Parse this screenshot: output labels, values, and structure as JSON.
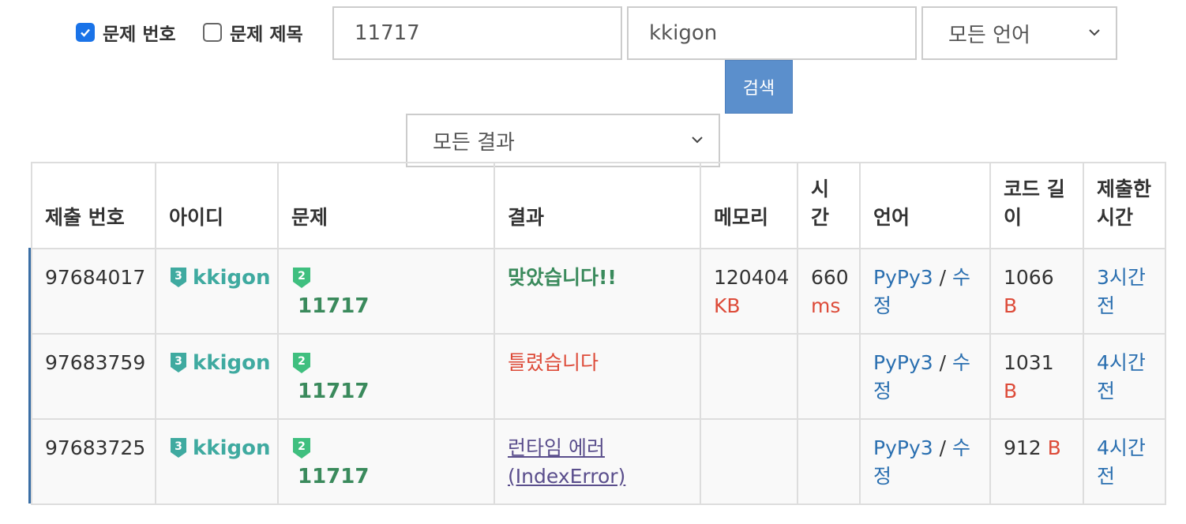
{
  "filters": {
    "problem_id_checkbox": {
      "label": "문제 번호",
      "checked": true
    },
    "problem_title_checkbox": {
      "label": "문제 제목",
      "checked": false
    },
    "problem_input": {
      "value": "11717"
    },
    "user_input": {
      "value": "kkigon"
    },
    "language_select": {
      "selected": "모든 언어"
    },
    "result_select": {
      "selected": "모든 결과"
    },
    "search_button": "검색"
  },
  "table": {
    "headers": [
      "제출 번호",
      "아이디",
      "문제",
      "결과",
      "메모리",
      "시간",
      "언어",
      "코드 길이",
      "제출한 시간"
    ],
    "rows": [
      {
        "submission_id": "97684017",
        "user": "kkigon",
        "user_tier": "3",
        "problem": "11717",
        "problem_tier": "2",
        "result": "맞았습니다!!",
        "result_type": "ok",
        "memory": "120404",
        "memory_unit": "KB",
        "time": "660",
        "time_unit": "ms",
        "language": "PyPy3",
        "separator": "/",
        "edit": "수정",
        "code_length": "1066",
        "code_unit": "B",
        "submitted": "3시간 전"
      },
      {
        "submission_id": "97683759",
        "user": "kkigon",
        "user_tier": "3",
        "problem": "11717",
        "problem_tier": "2",
        "result": "틀렸습니다",
        "result_type": "wa",
        "memory": "",
        "memory_unit": "",
        "time": "",
        "time_unit": "",
        "language": "PyPy3",
        "separator": "/",
        "edit": "수정",
        "code_length": "1031",
        "code_unit": "B",
        "submitted": "4시간 전"
      },
      {
        "submission_id": "97683725",
        "user": "kkigon",
        "user_tier": "3",
        "problem": "11717",
        "problem_tier": "2",
        "result": "런타임 에러 (IndexError)",
        "result_type": "re",
        "memory": "",
        "memory_unit": "",
        "time": "",
        "time_unit": "",
        "language": "PyPy3",
        "separator": "/",
        "edit": "수정",
        "code_length": "912",
        "code_unit": "B",
        "submitted": "4시간 전"
      }
    ]
  },
  "colors": {
    "accent": "#5b8fcc",
    "ok": "#3a8a5c",
    "error": "#dd4b39",
    "user_tier": "#3faaa0",
    "problem_tier": "#3fbf7f"
  }
}
